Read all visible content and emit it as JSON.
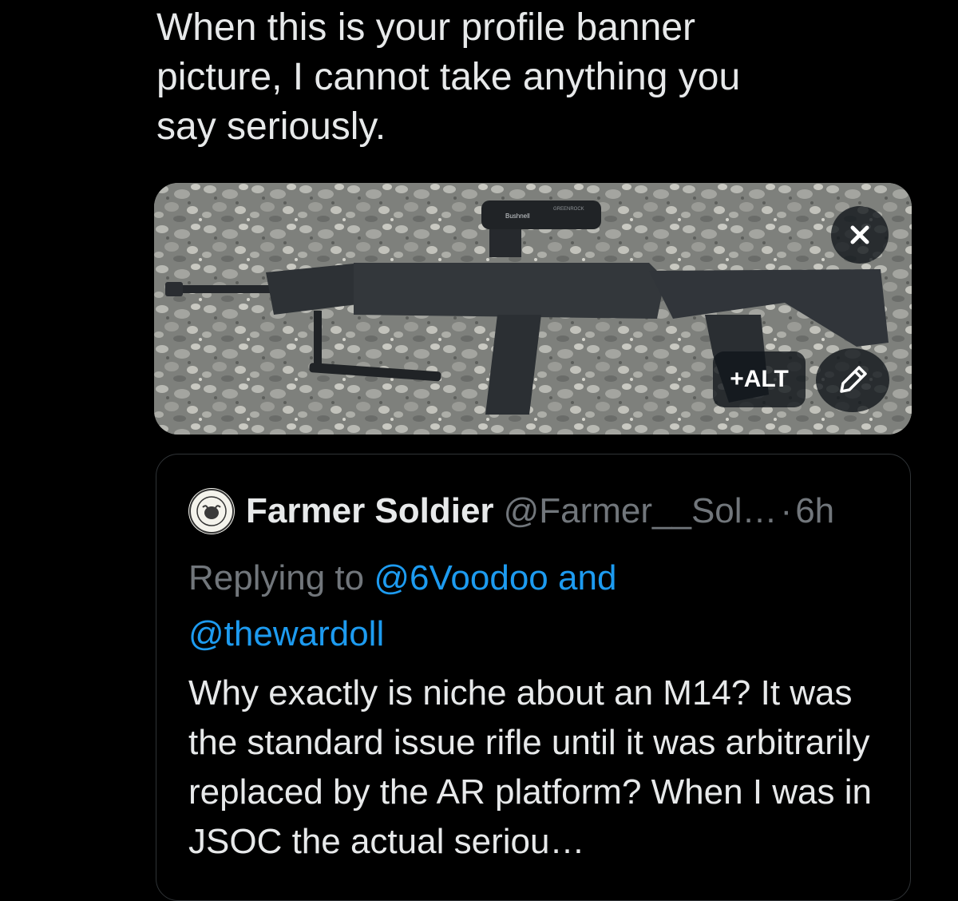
{
  "compose": {
    "text": "When this is your profile banner\npicture, I cannot take anything you\nsay seriously."
  },
  "media": {
    "close_icon": "close-icon",
    "alt_label": "+ALT",
    "edit_icon": "pencil-icon",
    "scope_brand": "Bushnell",
    "scope_brand2": "GREENROCK"
  },
  "quote": {
    "display_name": "Farmer Soldier",
    "handle": "@Farmer__Sol…",
    "dot": "·",
    "time": "6h",
    "replying_prefix": "Replying to ",
    "mention_1": "@6Voodoo",
    "and": " and",
    "mention_2": "@thewardoll",
    "body": "Why exactly is niche about an M14? It was the standard issue rifle until it was arbitrarily replaced by the AR platform? When I was in JSOC the actual seriou…"
  },
  "colors": {
    "background": "#000000",
    "text": "#e7e9ea",
    "secondary": "#71767b",
    "link": "#1d9bf0",
    "border": "#2f3336"
  }
}
